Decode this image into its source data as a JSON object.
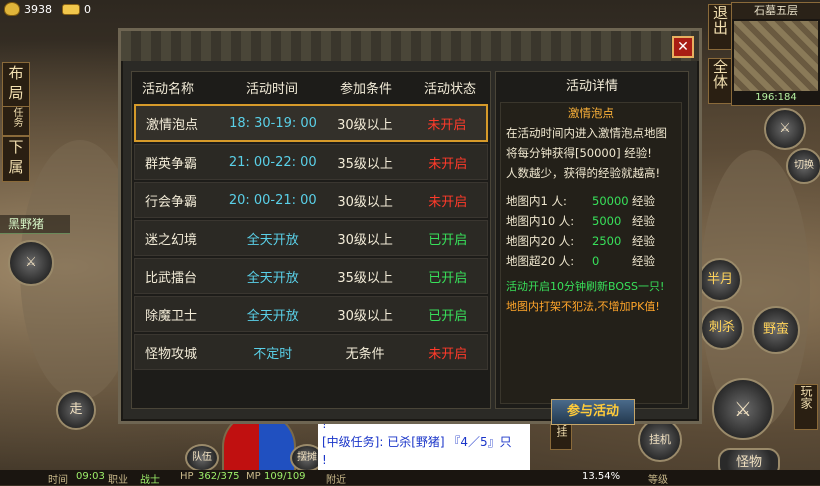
{
  "hud": {
    "gold": "3938",
    "ingot": "0",
    "left_buttons": [
      "布",
      "局",
      "任务",
      "下",
      "属"
    ],
    "target_name": "黑野猪",
    "walk_label": "走",
    "right_buttons": [
      "退出",
      "全体"
    ],
    "map_name": "石墓五层",
    "map_coords": "196:184",
    "switch_label": "切换",
    "skills": [
      "半月",
      "刺杀",
      "野蛮"
    ],
    "side_vertical_text": "玩家",
    "monster_btn": "怪物",
    "on_hook": "挂机",
    "inner_label": "内挂",
    "team_label": "队伍",
    "stall_label": "摆摊",
    "nearby_label": "附近"
  },
  "bottom": {
    "time_label": "时间",
    "time_value": "09:03",
    "job_label": "职业",
    "job_value": "战士",
    "hp_label": "HP",
    "hp_value": "362/375",
    "mp_label": "MP",
    "mp_value": "109/109",
    "exp_percent": "13.54%",
    "level_label": "等级"
  },
  "chat": [
    "!",
    "[中级任务]: 已杀[野猪] 『4／5』只",
    "!"
  ],
  "dialog": {
    "close": "✕",
    "headers": [
      "活动名称",
      "活动时间",
      "参加条件",
      "活动状态"
    ],
    "rows": [
      {
        "name": "激情泡点",
        "time": "18: 30-19: 00",
        "cond": "30级以上",
        "status": "未开启",
        "open": false
      },
      {
        "name": "群英争霸",
        "time": "21: 00-22: 00",
        "cond": "35级以上",
        "status": "未开启",
        "open": false
      },
      {
        "name": "行会争霸",
        "time": "20: 00-21: 00",
        "cond": "30级以上",
        "status": "未开启",
        "open": false
      },
      {
        "name": "迷之幻境",
        "time": "全天开放",
        "cond": "30级以上",
        "status": "已开启",
        "open": true
      },
      {
        "name": "比武擂台",
        "time": "全天开放",
        "cond": "35级以上",
        "status": "已开启",
        "open": true
      },
      {
        "name": "除魔卫士",
        "time": "全天开放",
        "cond": "30级以上",
        "status": "已开启",
        "open": true
      },
      {
        "name": "怪物攻城",
        "time": "不定时",
        "cond": "无条件",
        "status": "未开启",
        "open": false
      }
    ],
    "detail": {
      "title": "活动详情",
      "name": "激情泡点",
      "desc1": "在活动时间内进入激情泡点地图",
      "desc2": "将每分钟获得[50000] 经验!",
      "desc3": "人数越少，获得的经验就越高!",
      "grid": [
        {
          "label": "地图内1 人:",
          "value": "50000",
          "unit": "经验"
        },
        {
          "label": "地图内10 人:",
          "value": "5000",
          "unit": "经验"
        },
        {
          "label": "地图内20 人:",
          "value": "2500",
          "unit": "经验"
        },
        {
          "label": "地图超20 人:",
          "value": "0",
          "unit": "经验"
        }
      ],
      "note1": "活动开启10分钟刷新BOSS一只!",
      "note2": "地图内打架不犯法,不增加PK值!",
      "join": "参与活动"
    }
  }
}
